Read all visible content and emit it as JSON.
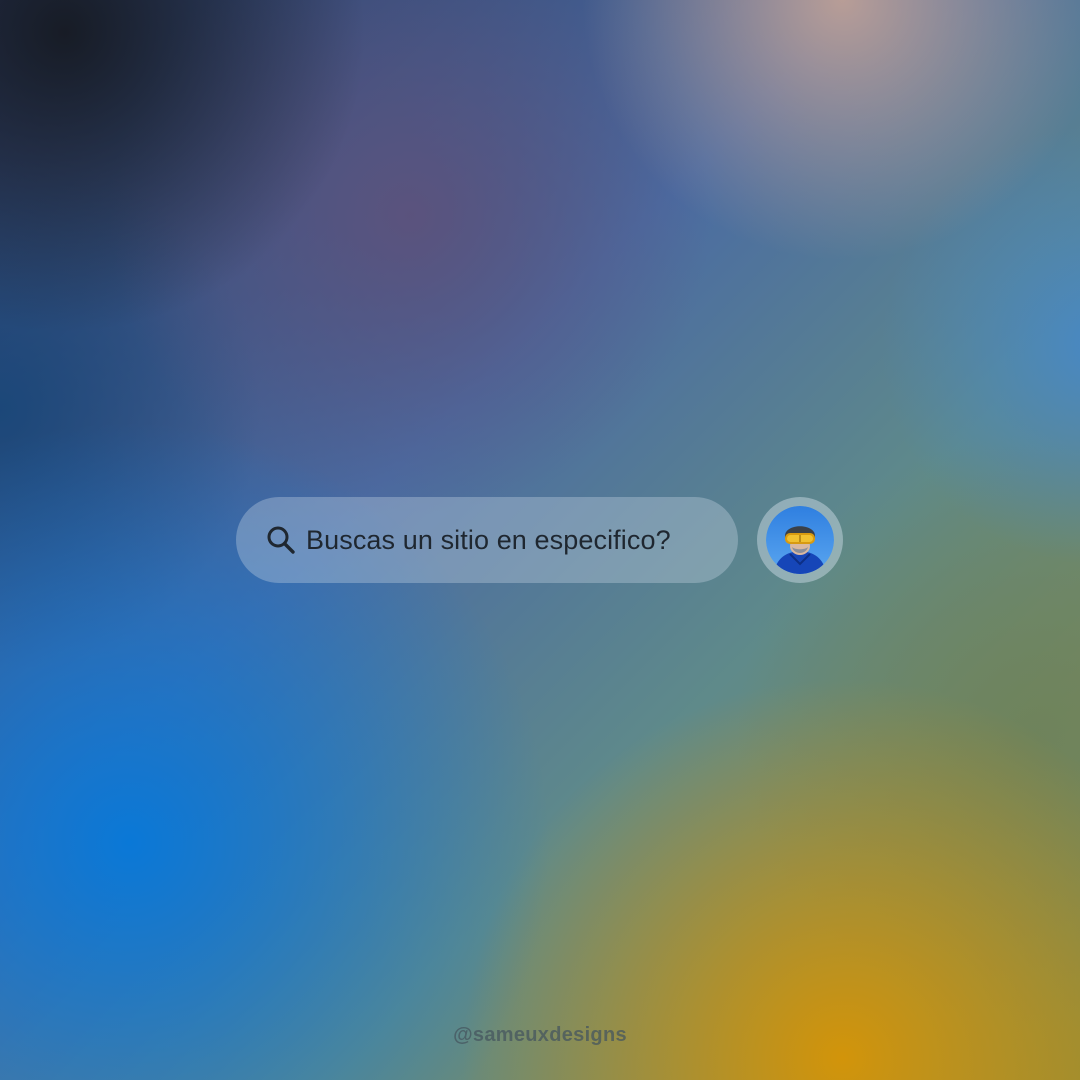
{
  "search": {
    "placeholder": "Buscas un sitio en especifico?",
    "icon": "search-icon"
  },
  "profile": {
    "avatar_icon": "user-avatar-skier"
  },
  "footer": {
    "handle": "@sameuxdesigns"
  },
  "colors": {
    "search_text": "#1f2730",
    "watermark": "#46555f"
  }
}
